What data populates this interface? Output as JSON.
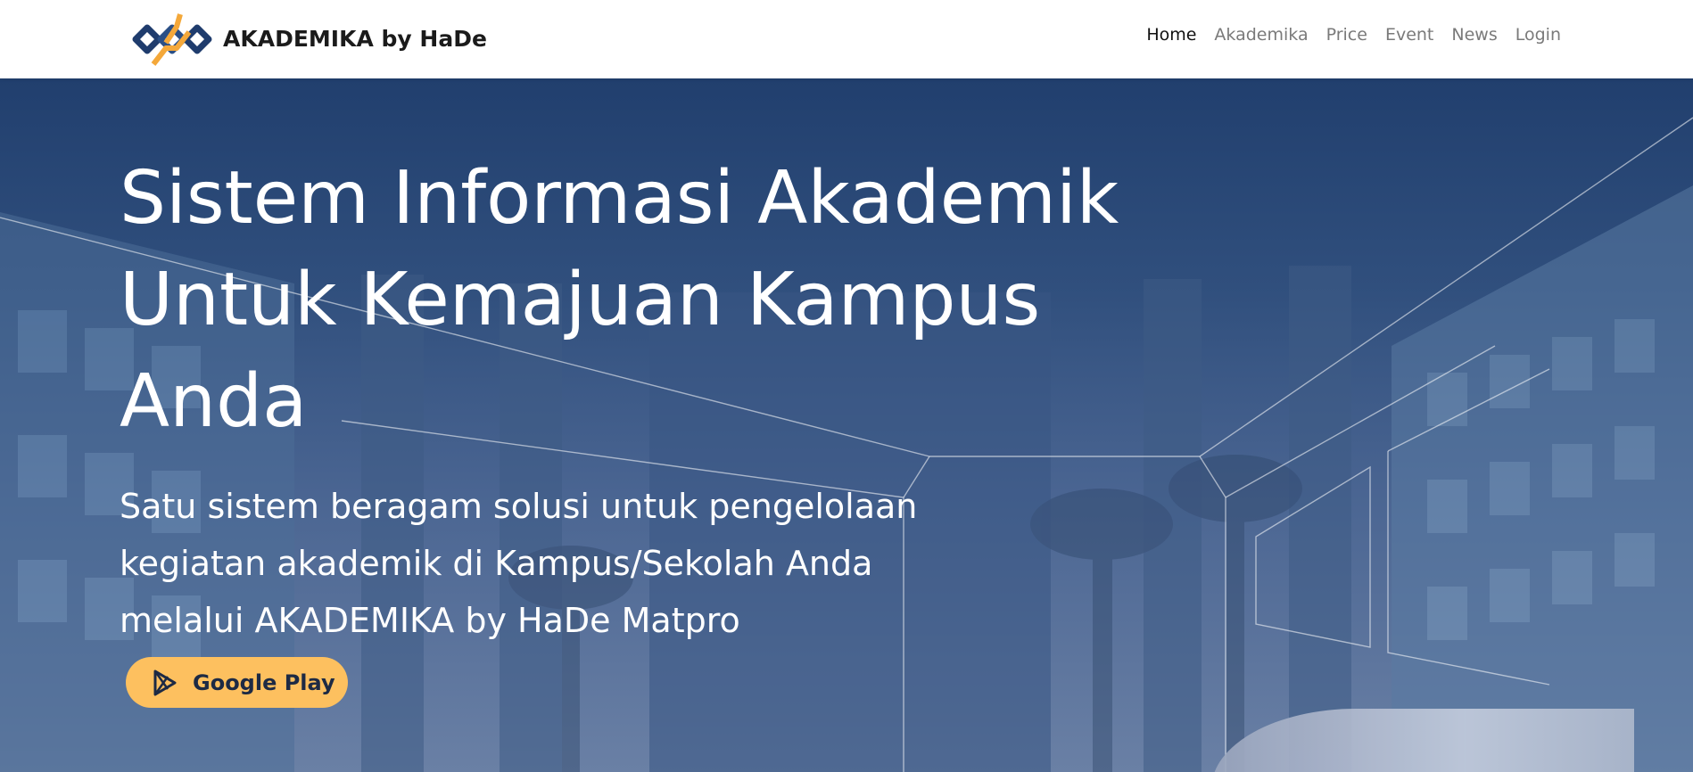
{
  "brand": {
    "name": "AKADEMIKA by HaDe",
    "logo_icon": "akademika-logo-icon",
    "logo_colors": {
      "primary": "#1f3c6d",
      "accent": "#f4a83a"
    }
  },
  "nav": {
    "items": [
      {
        "label": "Home",
        "active": true
      },
      {
        "label": "Akademika",
        "active": false
      },
      {
        "label": "Price",
        "active": false
      },
      {
        "label": "Event",
        "active": false
      },
      {
        "label": "News",
        "active": false
      },
      {
        "label": "Login",
        "active": false
      }
    ]
  },
  "hero": {
    "title": "Sistem Informasi Akademik Untuk Kemajuan Kampus Anda",
    "subtitle": "Satu sistem beragam solusi untuk pengelolaan kegiatan akademik di Kampus/Sekolah Anda melalui AKADEMIKA by HaDe Matpro",
    "background_color": "#2a4777",
    "cta": {
      "label": "Google Play",
      "icon": "google-play-icon",
      "background_color": "#fdc05f"
    }
  }
}
